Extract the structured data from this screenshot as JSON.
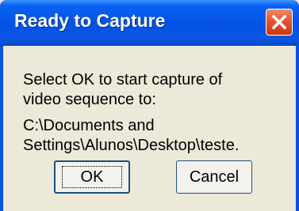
{
  "dialog": {
    "title": "Ready to Capture",
    "message_line1": "Select OK to start capture of\nvideo sequence to:",
    "message_line2": "C:\\Documents and\nSettings\\Alunos\\Desktop\\teste.",
    "ok_label": "OK",
    "cancel_label": "Cancel",
    "close_icon": "close-icon",
    "colors": {
      "titlebar": "#0553e6",
      "close_button": "#e2542f",
      "body": "#ece9d8"
    }
  }
}
